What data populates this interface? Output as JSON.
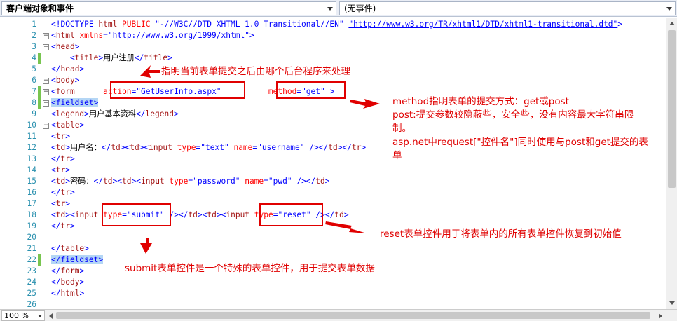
{
  "toolbar": {
    "object_dropdown": "客户端对象和事件",
    "event_dropdown": "(无事件)"
  },
  "lines": [
    {
      "n": "1",
      "parts": [
        [
          "b",
          "<!DOCTYPE "
        ],
        [
          "t",
          "html"
        ],
        [
          "a",
          " PUBLIC "
        ],
        [
          "v",
          "\"-//W3C//DTD XHTML 1.0 Transitional//EN\" "
        ],
        [
          "lk",
          "\"http://www.w3.org/TR/xhtml1/DTD/xhtml1-transitional.dtd\""
        ],
        [
          "b",
          ">"
        ]
      ]
    },
    {
      "n": "2",
      "parts": [
        [
          "b",
          "<"
        ],
        [
          "t",
          "html"
        ],
        [
          "a",
          " xmlns"
        ],
        [
          "b",
          "="
        ],
        [
          "lk",
          "\"http://www.w3.org/1999/xhtml\""
        ],
        [
          "b",
          ">"
        ]
      ]
    },
    {
      "n": "3",
      "parts": [
        [
          "b",
          "<"
        ],
        [
          "t",
          "head"
        ],
        [
          "b",
          ">"
        ]
      ]
    },
    {
      "n": "4",
      "parts": [
        [
          "k",
          "    "
        ],
        [
          "b",
          "<"
        ],
        [
          "t",
          "title"
        ],
        [
          "b",
          ">"
        ],
        [
          "k",
          "用户注册"
        ],
        [
          "b",
          "</"
        ],
        [
          "t",
          "title"
        ],
        [
          "b",
          ">"
        ]
      ]
    },
    {
      "n": "5",
      "parts": [
        [
          "b",
          "</"
        ],
        [
          "t",
          "head"
        ],
        [
          "b",
          ">"
        ]
      ]
    },
    {
      "n": "6",
      "parts": [
        [
          "b",
          "<"
        ],
        [
          "t",
          "body"
        ],
        [
          "b",
          ">"
        ]
      ]
    },
    {
      "n": "7",
      "parts": [
        [
          "b",
          "<"
        ],
        [
          "t",
          "form"
        ],
        [
          "k",
          "      "
        ],
        [
          "a",
          "action"
        ],
        [
          "b",
          "="
        ],
        [
          "v",
          "\"GetUserInfo.aspx\""
        ],
        [
          "k",
          "          "
        ],
        [
          "a",
          "method"
        ],
        [
          "b",
          "="
        ],
        [
          "v",
          "\"get\""
        ],
        [
          "k",
          " "
        ],
        [
          "b",
          ">"
        ]
      ]
    },
    {
      "n": "8",
      "parts": [
        [
          "hl",
          "<fieldset>"
        ]
      ]
    },
    {
      "n": "9",
      "parts": [
        [
          "b",
          "<"
        ],
        [
          "t",
          "legend"
        ],
        [
          "b",
          ">"
        ],
        [
          "k",
          "用户基本资料"
        ],
        [
          "b",
          "</"
        ],
        [
          "t",
          "legend"
        ],
        [
          "b",
          ">"
        ]
      ]
    },
    {
      "n": "10",
      "parts": [
        [
          "b",
          "<"
        ],
        [
          "t",
          "table"
        ],
        [
          "b",
          ">"
        ]
      ]
    },
    {
      "n": "11",
      "parts": [
        [
          "b",
          "<"
        ],
        [
          "t",
          "tr"
        ],
        [
          "b",
          ">"
        ]
      ]
    },
    {
      "n": "12",
      "parts": [
        [
          "b",
          "<"
        ],
        [
          "t",
          "td"
        ],
        [
          "b",
          ">"
        ],
        [
          "k",
          "用户名："
        ],
        [
          "b",
          "</"
        ],
        [
          "t",
          "td"
        ],
        [
          "b",
          "><"
        ],
        [
          "t",
          "td"
        ],
        [
          "b",
          "><"
        ],
        [
          "t",
          "input"
        ],
        [
          "a",
          " type"
        ],
        [
          "b",
          "="
        ],
        [
          "v",
          "\"text\""
        ],
        [
          "a",
          " name"
        ],
        [
          "b",
          "="
        ],
        [
          "v",
          "\"username\""
        ],
        [
          "b",
          " /></"
        ],
        [
          "t",
          "td"
        ],
        [
          "b",
          "></"
        ],
        [
          "t",
          "tr"
        ],
        [
          "b",
          ">"
        ]
      ]
    },
    {
      "n": "13",
      "parts": [
        [
          "b",
          "</"
        ],
        [
          "t",
          "tr"
        ],
        [
          "b",
          ">"
        ]
      ]
    },
    {
      "n": "14",
      "parts": [
        [
          "b",
          "<"
        ],
        [
          "t",
          "tr"
        ],
        [
          "b",
          ">"
        ]
      ]
    },
    {
      "n": "15",
      "parts": [
        [
          "b",
          "<"
        ],
        [
          "t",
          "td"
        ],
        [
          "b",
          ">"
        ],
        [
          "k",
          "密码："
        ],
        [
          "b",
          "</"
        ],
        [
          "t",
          "td"
        ],
        [
          "b",
          "><"
        ],
        [
          "t",
          "td"
        ],
        [
          "b",
          "><"
        ],
        [
          "t",
          "input"
        ],
        [
          "a",
          " type"
        ],
        [
          "b",
          "="
        ],
        [
          "v",
          "\"password\""
        ],
        [
          "a",
          " name"
        ],
        [
          "b",
          "="
        ],
        [
          "v",
          "\"pwd\""
        ],
        [
          "b",
          " /></"
        ],
        [
          "t",
          "td"
        ],
        [
          "b",
          ">"
        ]
      ]
    },
    {
      "n": "16",
      "parts": [
        [
          "b",
          "</"
        ],
        [
          "t",
          "tr"
        ],
        [
          "b",
          ">"
        ]
      ]
    },
    {
      "n": "17",
      "parts": [
        [
          "b",
          "<"
        ],
        [
          "t",
          "tr"
        ],
        [
          "b",
          ">"
        ]
      ]
    },
    {
      "n": "18",
      "parts": [
        [
          "b",
          "<"
        ],
        [
          "t",
          "td"
        ],
        [
          "b",
          "><"
        ],
        [
          "t",
          "input"
        ],
        [
          "a",
          " type"
        ],
        [
          "b",
          "="
        ],
        [
          "v",
          "\"submit\""
        ],
        [
          "b",
          " /></"
        ],
        [
          "t",
          "td"
        ],
        [
          "b",
          "><"
        ],
        [
          "t",
          "td"
        ],
        [
          "b",
          "><"
        ],
        [
          "t",
          "input"
        ],
        [
          "a",
          " type"
        ],
        [
          "b",
          "="
        ],
        [
          "v",
          "\"reset\""
        ],
        [
          "b",
          " /></"
        ],
        [
          "t",
          "td"
        ],
        [
          "b",
          ">"
        ]
      ]
    },
    {
      "n": "19",
      "parts": [
        [
          "b",
          "</"
        ],
        [
          "t",
          "tr"
        ],
        [
          "b",
          ">"
        ]
      ]
    },
    {
      "n": "20",
      "parts": []
    },
    {
      "n": "21",
      "parts": [
        [
          "b",
          "</"
        ],
        [
          "t",
          "table"
        ],
        [
          "b",
          ">"
        ]
      ]
    },
    {
      "n": "22",
      "parts": [
        [
          "hl",
          "</fieldset>"
        ]
      ]
    },
    {
      "n": "23",
      "parts": [
        [
          "b",
          "</"
        ],
        [
          "t",
          "form"
        ],
        [
          "b",
          ">"
        ]
      ]
    },
    {
      "n": "24",
      "parts": [
        [
          "b",
          "</"
        ],
        [
          "t",
          "body"
        ],
        [
          "b",
          ">"
        ]
      ]
    },
    {
      "n": "25",
      "parts": [
        [
          "b",
          "</"
        ],
        [
          "t",
          "html"
        ],
        [
          "b",
          ">"
        ]
      ]
    },
    {
      "n": "26",
      "parts": []
    }
  ],
  "annotations": {
    "action_note": "指明当前表单提交之后由哪个后台程序来处理",
    "method_note_1": "method指明表单的提交方式：get或post",
    "method_note_2": "post:提交参数较隐蔽些，安全些，没有内容最大字符串限",
    "method_note_3": "制。",
    "method_note_4": "asp.net中request[\"控件名\"]同时使用与post和get提交的表",
    "method_note_5": "单",
    "reset_note": "reset表单控件用于将表单内的所有表单控件恢复到初始值",
    "submit_note": "submit表单控件是一个特殊的表单控件，用于提交表单数据"
  },
  "statusbar": {
    "zoom": "100 %"
  },
  "colors": {
    "annotation": "#e00000",
    "line_number": "#2b91af",
    "change_bar": "#78c550"
  }
}
